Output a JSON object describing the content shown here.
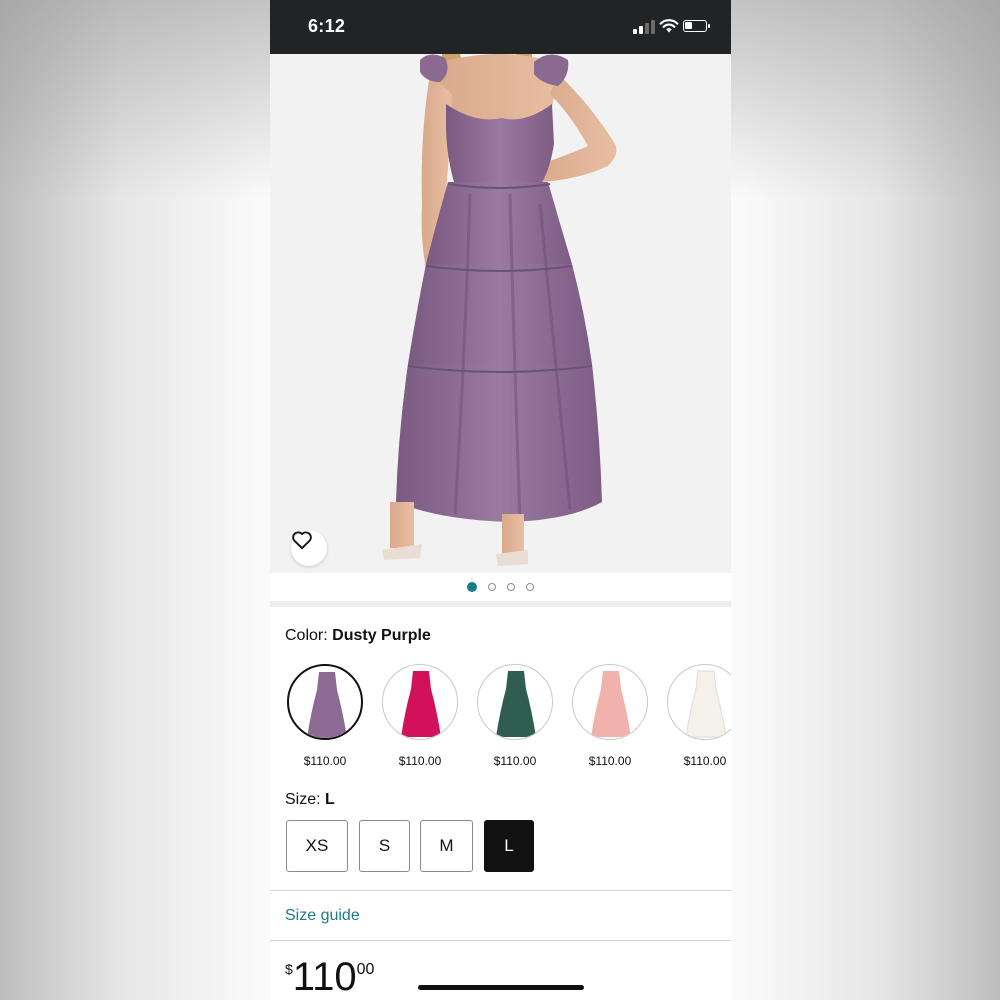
{
  "status_bar": {
    "time": "6:12"
  },
  "product": {
    "image_count": 4,
    "active_image_index": 0,
    "color_label": "Color:",
    "color_value": "Dusty Purple",
    "swatches": [
      {
        "color_name": "dusty-purple",
        "hex": "#8d6a93",
        "price": "$110.00",
        "selected": true
      },
      {
        "color_name": "pink",
        "hex": "#d3105a",
        "price": "$110.00",
        "selected": false
      },
      {
        "color_name": "green",
        "hex": "#2f5d50",
        "price": "$110.00",
        "selected": false
      },
      {
        "color_name": "blush",
        "hex": "#f0b2aa",
        "price": "$110.00",
        "selected": false
      },
      {
        "color_name": "white",
        "hex": "#f3f1ea",
        "price": "$110.00",
        "selected": false
      }
    ],
    "size_label": "Size:",
    "size_value": "L",
    "sizes": [
      {
        "label": "XS",
        "selected": false
      },
      {
        "label": "S",
        "selected": false
      },
      {
        "label": "M",
        "selected": false
      },
      {
        "label": "L",
        "selected": true
      }
    ],
    "size_guide": "Size guide",
    "price": {
      "currency": "$",
      "whole": "110",
      "cents": "00"
    }
  },
  "colors": {
    "accent": "#1a7b8a",
    "dress": "#8d6a93",
    "status_bar": "#222325"
  },
  "icons": {
    "favorite": "heart-outline-icon",
    "wifi": "wifi-icon",
    "battery": "battery-icon",
    "signal": "cellular-signal-icon"
  }
}
